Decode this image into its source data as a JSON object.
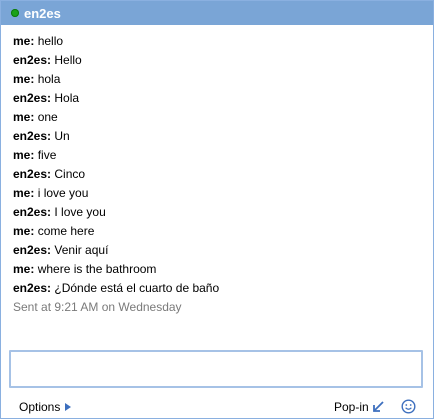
{
  "header": {
    "title": "en2es",
    "status_color": "#1aa21a",
    "bar_color": "#7aa5d6"
  },
  "messages": [
    {
      "sender": "me:",
      "text": "hello"
    },
    {
      "sender": "en2es:",
      "text": "Hello"
    },
    {
      "sender": "me:",
      "text": "hola"
    },
    {
      "sender": "en2es:",
      "text": "Hola"
    },
    {
      "sender": "me:",
      "text": "one"
    },
    {
      "sender": "en2es:",
      "text": "Un"
    },
    {
      "sender": "me:",
      "text": "five"
    },
    {
      "sender": "en2es:",
      "text": "Cinco"
    },
    {
      "sender": "me:",
      "text": "i love you"
    },
    {
      "sender": "en2es:",
      "text": "I love you"
    },
    {
      "sender": "me:",
      "text": "come here"
    },
    {
      "sender": "en2es:",
      "text": "Venir aquí"
    },
    {
      "sender": "me:",
      "text": "where is the bathroom"
    },
    {
      "sender": "en2es:",
      "text": "¿Dónde está el cuarto de baño"
    }
  ],
  "sent_info": "Sent at 9:21 AM on Wednesday",
  "input": {
    "value": ""
  },
  "footer": {
    "options_label": "Options",
    "popin_label": "Pop-in",
    "emoticon_icon": "smiley-icon",
    "popin_icon": "arrow-down-left-icon",
    "options_icon": "triangle-right-icon"
  }
}
